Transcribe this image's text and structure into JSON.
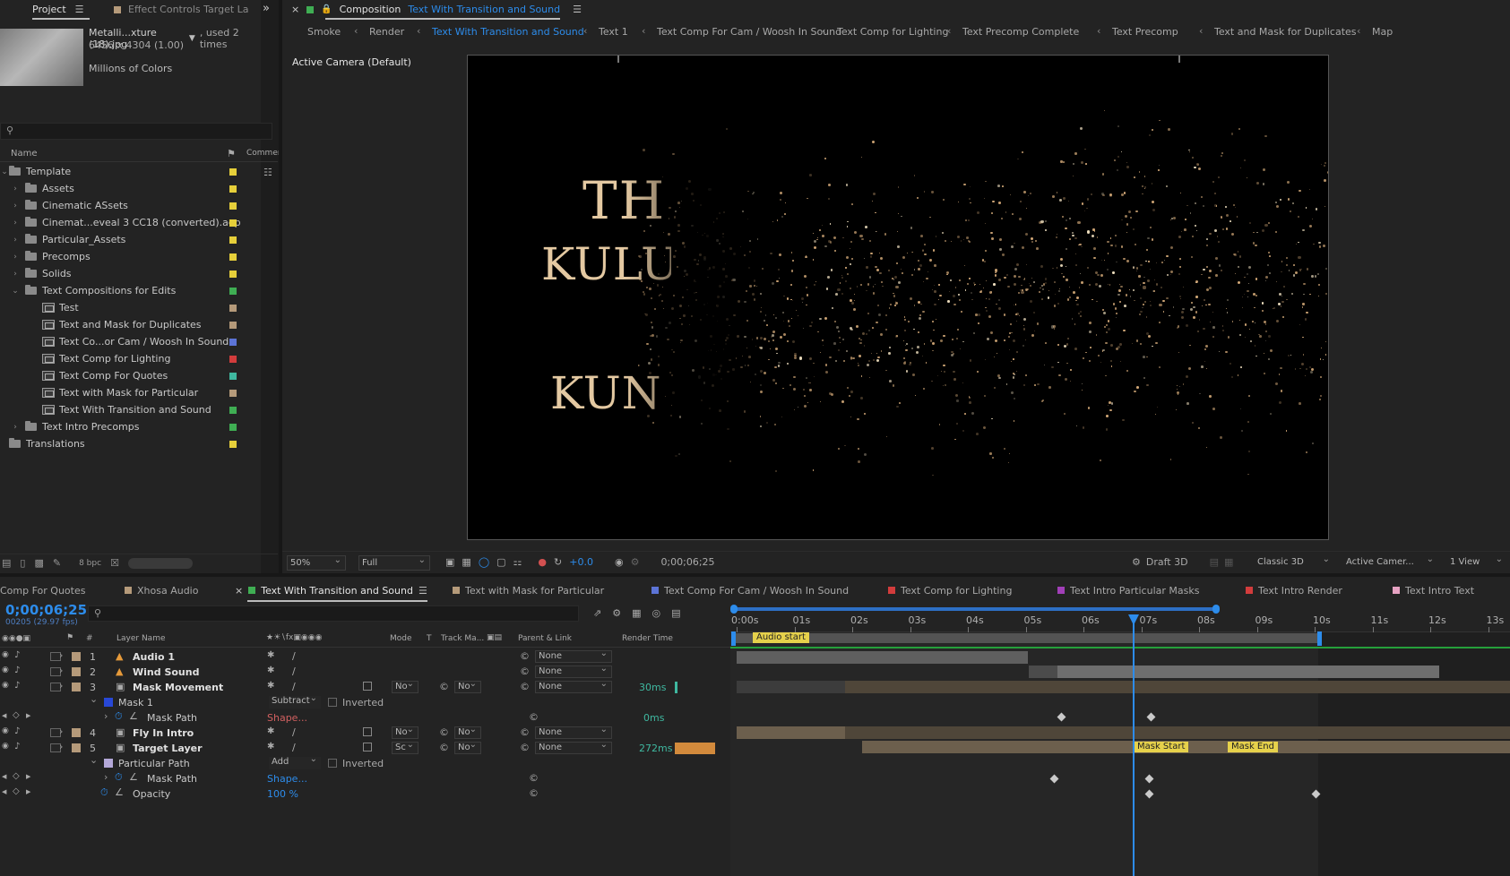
{
  "project_panel": {
    "tab_project": "Project",
    "tab_effect_controls": "Effect Controls  Target La",
    "asset_name": "Metalli...xture (18).jpg",
    "asset_used": ", used 2 times",
    "asset_dims": "6456 x 4304 (1.00)",
    "asset_colors": "Millions of Colors",
    "col_name": "Name",
    "col_comment": "Commen",
    "bpc": "8 bpc",
    "items": [
      {
        "label": "Template",
        "kind": "folder",
        "indent": 0,
        "chev": "v",
        "color": "#e6cf3a"
      },
      {
        "label": "Assets",
        "kind": "folder",
        "indent": 1,
        "chev": ">",
        "color": "#e6cf3a"
      },
      {
        "label": "Cinematic ASsets",
        "kind": "folder",
        "indent": 1,
        "chev": ">",
        "color": "#e6cf3a"
      },
      {
        "label": "Cinemat...eveal 3 CC18 (converted).aep",
        "kind": "folder",
        "indent": 1,
        "chev": ">",
        "color": "#e6cf3a"
      },
      {
        "label": "Particular_Assets",
        "kind": "folder",
        "indent": 1,
        "chev": ">",
        "color": "#e6cf3a"
      },
      {
        "label": "Precomps",
        "kind": "folder",
        "indent": 1,
        "chev": ">",
        "color": "#e6cf3a"
      },
      {
        "label": "Solids",
        "kind": "folder",
        "indent": 1,
        "chev": ">",
        "color": "#e6cf3a"
      },
      {
        "label": "Text Compositions for Edits",
        "kind": "folder",
        "indent": 1,
        "chev": "v",
        "color": "#3fae53"
      },
      {
        "label": "Test",
        "kind": "comp",
        "indent": 2,
        "chev": "",
        "color": "#b59a7a"
      },
      {
        "label": "Text and Mask for Duplicates",
        "kind": "comp",
        "indent": 2,
        "chev": "",
        "color": "#b59a7a"
      },
      {
        "label": "Text Co...or Cam / Woosh In Sound",
        "kind": "comp",
        "indent": 2,
        "chev": "",
        "color": "#5c74d6"
      },
      {
        "label": "Text Comp for Lighting",
        "kind": "comp",
        "indent": 2,
        "chev": "",
        "color": "#d23c3c"
      },
      {
        "label": "Text Comp For Quotes",
        "kind": "comp",
        "indent": 2,
        "chev": "",
        "color": "#3fb8a0"
      },
      {
        "label": "Text with Mask for Particular",
        "kind": "comp",
        "indent": 2,
        "chev": "",
        "color": "#b59a7a"
      },
      {
        "label": "Text With Transition and Sound",
        "kind": "comp",
        "indent": 2,
        "chev": "",
        "color": "#3fae53"
      },
      {
        "label": "Text Intro Precomps",
        "kind": "folder",
        "indent": 1,
        "chev": ">",
        "color": "#3fae53"
      },
      {
        "label": "Translations",
        "kind": "folder",
        "indent": 0,
        "chev": "",
        "color": "#e6cf3a"
      }
    ]
  },
  "composition_panel": {
    "title_prefix": "Composition",
    "title_name": "Text With Transition and Sound",
    "breadcrumbs": [
      "Smoke",
      "Render",
      "Text With Transition and Sound",
      "Text 1",
      "Text Comp For Cam / Woosh In Sound",
      "Text Comp for Lighting",
      "Text Precomp Complete",
      "Text Precomp",
      "Text and Mask for Duplicates",
      "Map"
    ],
    "camera_label": "Active Camera (Default)",
    "viewer_text": [
      "TH",
      "KULU",
      "KUN"
    ],
    "footer": {
      "zoom": "50%",
      "resolution": "Full",
      "exposure": "+0.0",
      "timecode": "0;00;06;25",
      "draft3d": "Draft 3D",
      "renderer": "Classic 3D",
      "camera": "Active Camer...",
      "views": "1 View"
    }
  },
  "timeline": {
    "tabs": [
      {
        "label": "Comp For Quotes",
        "color": ""
      },
      {
        "label": "Xhosa Audio",
        "color": "#b59a7a"
      },
      {
        "label": "Text With Transition and Sound",
        "color": "#3fae53",
        "active": true
      },
      {
        "label": "Text with Mask for Particular",
        "color": "#b59a7a"
      },
      {
        "label": "Text Comp For Cam / Woosh In Sound",
        "color": "#5c74d6"
      },
      {
        "label": "Text Comp for Lighting",
        "color": "#d23c3c"
      },
      {
        "label": "Text Intro Particular Masks",
        "color": "#a13fb8"
      },
      {
        "label": "Text Intro Render",
        "color": "#d23c3c"
      },
      {
        "label": "Text Intro Text",
        "color": "#e6a2c2"
      }
    ],
    "timecode": "0;00;06;25",
    "frames": "00205 (29.97 fps)",
    "col_layer_name": "Layer Name",
    "col_mode": "Mode",
    "col_t": "T",
    "col_track_matte": "Track Ma...",
    "col_parent": "Parent & Link",
    "col_render_time": "Render Time",
    "ruler": [
      "0:00s",
      "01s",
      "02s",
      "03s",
      "04s",
      "05s",
      "06s",
      "07s",
      "08s",
      "09s",
      "10s",
      "11s",
      "12s",
      "13s"
    ],
    "layers": [
      {
        "num": "1",
        "name": "Audio 1",
        "kind": "audio",
        "parent": "None"
      },
      {
        "num": "2",
        "name": "Wind Sound",
        "kind": "audio",
        "parent": "None"
      },
      {
        "num": "3",
        "name": "Mask Movement",
        "kind": "comp",
        "mode": "No",
        "matte": "No",
        "parent": "None",
        "render_time": "30ms"
      },
      {
        "name": "Mask 1",
        "kind": "mask",
        "mask_mode": "Subtract",
        "inverted": "Inverted"
      },
      {
        "name": "Mask Path",
        "kind": "prop",
        "value": "Shape...",
        "render_time": "0ms"
      },
      {
        "num": "4",
        "name": "Fly In Intro",
        "kind": "comp",
        "mode": "No",
        "matte": "No",
        "parent": "None"
      },
      {
        "num": "5",
        "name": "Target Layer",
        "kind": "comp",
        "mode": "Sc",
        "matte": "No",
        "parent": "None",
        "render_time": "272ms"
      },
      {
        "name": "Particular Path",
        "kind": "mask",
        "mask_mode": "Add",
        "inverted": "Inverted"
      },
      {
        "name": "Mask Path",
        "kind": "prop",
        "value": "Shape..."
      },
      {
        "name": "Opacity",
        "kind": "prop",
        "value": "100 %"
      }
    ],
    "markers": [
      "Audio start",
      "Mask Start",
      "Mask End"
    ]
  }
}
